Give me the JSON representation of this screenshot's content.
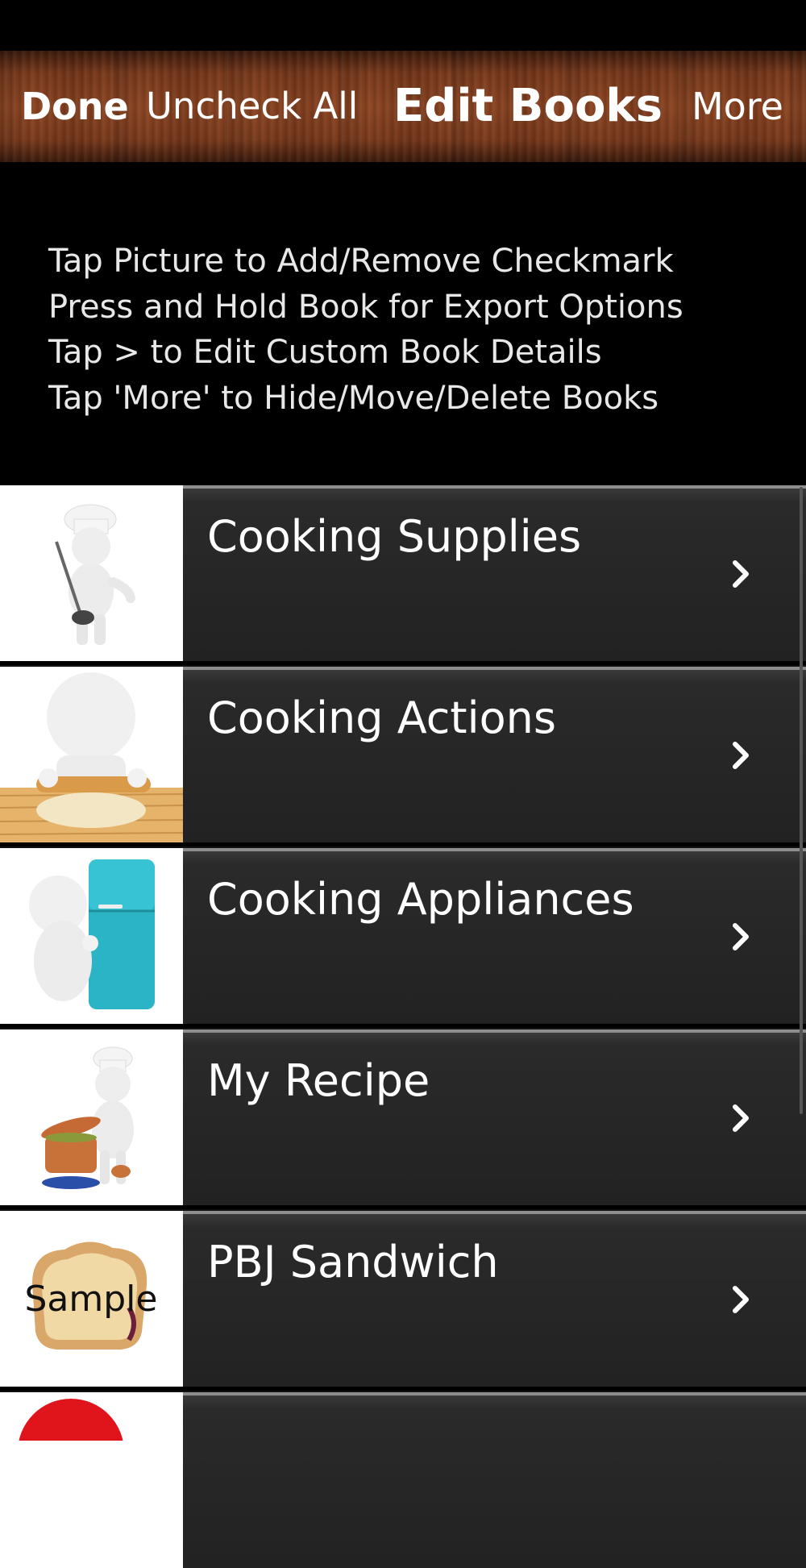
{
  "navbar": {
    "done_label": "Done",
    "uncheck_label": "Uncheck All",
    "title": "Edit Books",
    "more_label": "More"
  },
  "instructions": [
    "Tap Picture to Add/Remove Checkmark",
    "Press and Hold Book for Export Options",
    "Tap > to Edit Custom Book Details",
    "Tap 'More' to Hide/Move/Delete Books"
  ],
  "books": [
    {
      "title": "Cooking Supplies",
      "image": "chef-with-ladle"
    },
    {
      "title": "Cooking Actions",
      "image": "rolling-pin-figure"
    },
    {
      "title": "Cooking Appliances",
      "image": "figure-with-refrigerator"
    },
    {
      "title": "My Recipe",
      "image": "chef-with-pot"
    },
    {
      "title": "PBJ Sandwich",
      "image": "sandwich",
      "thumb_label": "Sample"
    },
    {
      "title": "",
      "image": "red-circle"
    }
  ]
}
